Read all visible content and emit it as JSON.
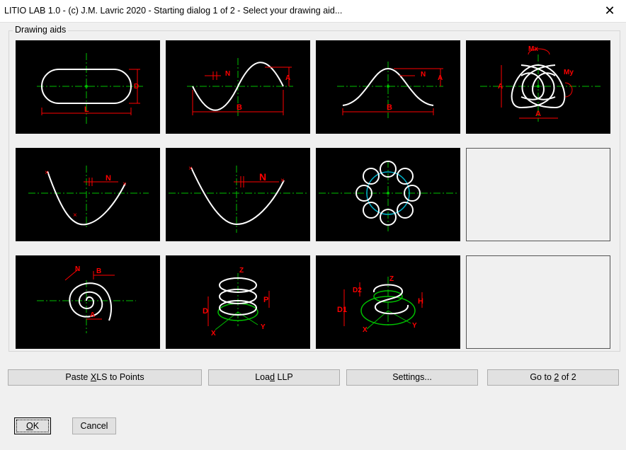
{
  "window": {
    "title": "LITIO LAB 1.0 - (c) J.M. Lavric 2020 - Starting dialog 1 of 2 - Select your drawing aid...",
    "close_label": "✕"
  },
  "group": {
    "label": "Drawing aids"
  },
  "tile_labels": {
    "L": "L",
    "D": "D",
    "N": "N",
    "A": "A",
    "B": "B",
    "Mx": "Mx",
    "My": "My",
    "Z": "Z",
    "Y": "Y",
    "X": "X",
    "P": "P",
    "D1": "D1",
    "D2": "D2",
    "H": "H"
  },
  "buttons": {
    "paste_pre": "Paste ",
    "paste_key": "X",
    "paste_post": "LS to Points",
    "load_pre": "Loa",
    "load_key": "d",
    "load_post": " LLP",
    "settings": "Settings...",
    "goto_pre": "Go to ",
    "goto_key": "2",
    "goto_post": " of 2",
    "ok_key": "O",
    "ok_post": "K",
    "cancel": "Cancel"
  },
  "colors": {
    "dim": "#ff0000",
    "axis": "#00c000",
    "curve": "#ffffff",
    "helix": "#00a0c0"
  }
}
